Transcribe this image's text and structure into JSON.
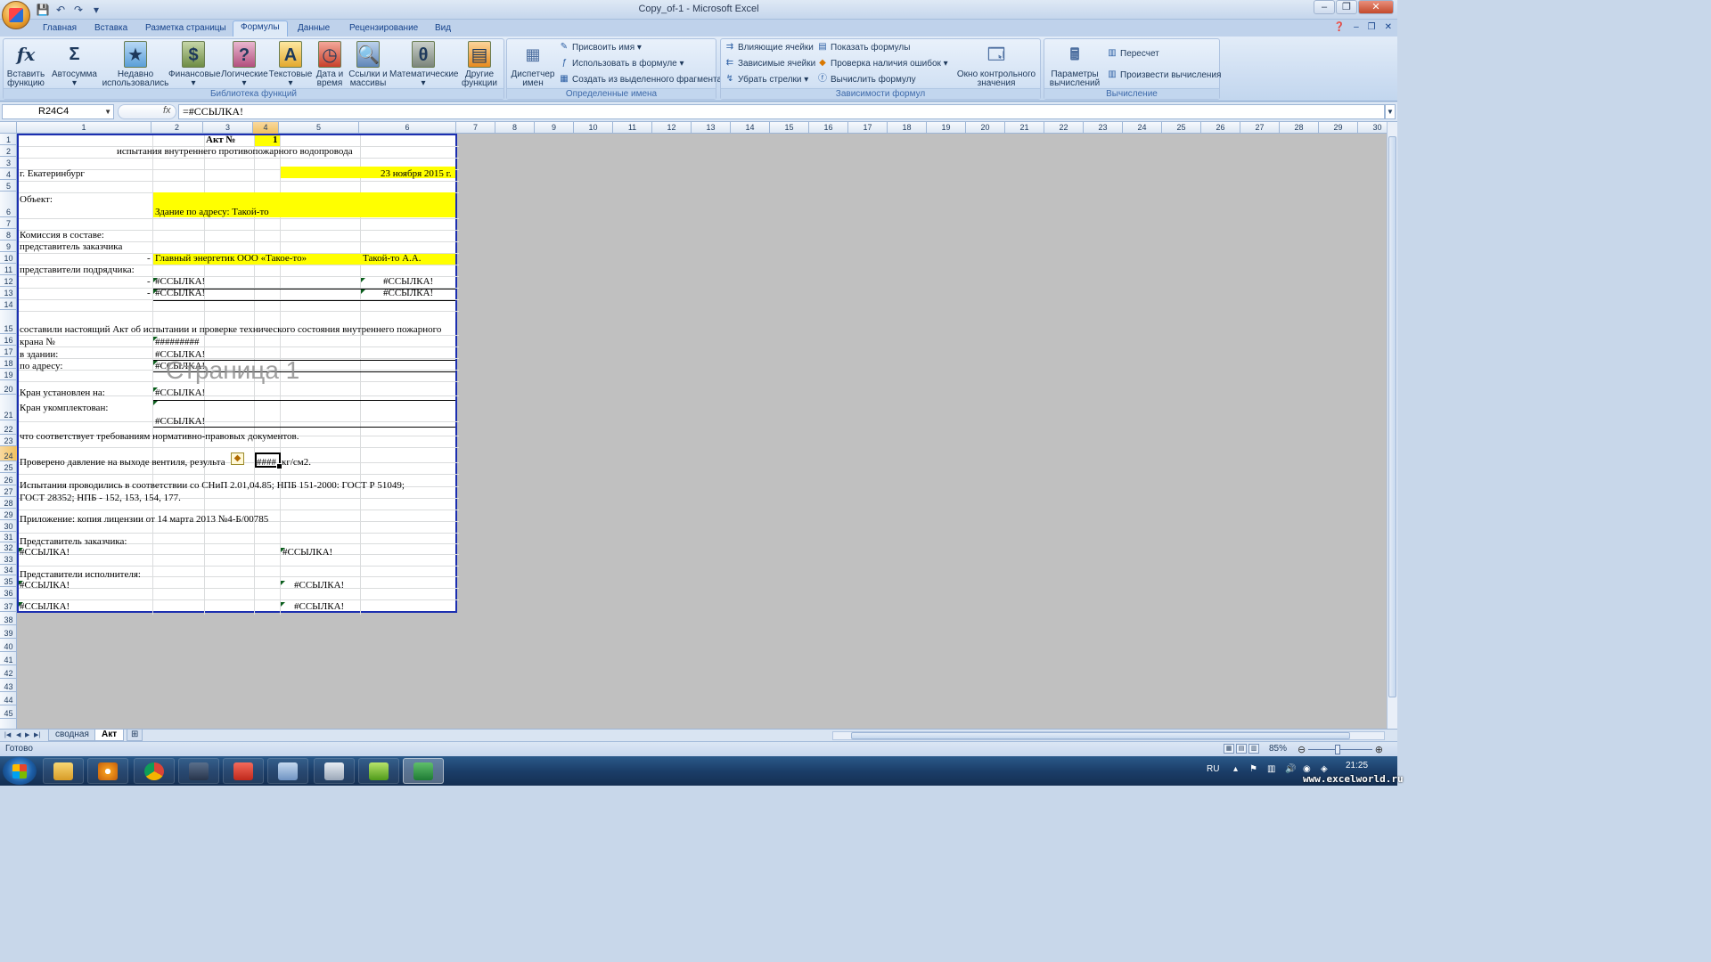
{
  "window": {
    "title": "Copy_of-1 - Microsoft Excel"
  },
  "tabs": [
    "Главная",
    "Вставка",
    "Разметка страницы",
    "Формулы",
    "Данные",
    "Рецензирование",
    "Вид"
  ],
  "active_tab": "Формулы",
  "ribbon": {
    "groups": {
      "library": "Библиотека функций",
      "names": "Определенные имена",
      "dependencies": "Зависимости формул",
      "calculation": "Вычисление"
    },
    "buttons": {
      "insert_function": "Вставить\nфункцию",
      "autosum": "Автосумма",
      "recent": "Недавно\nиспользовались",
      "financial": "Финансовые",
      "logical": "Логические",
      "text": "Текстовые",
      "datetime": "Дата и\nвремя",
      "lookup": "Ссылки и\nмассивы",
      "math": "Математические",
      "other": "Другие\nфункции",
      "name_manager": "Диспетчер\nимен",
      "define_name": "Присвоить имя",
      "use_in_formula": "Использовать в формуле",
      "create_from_selection": "Создать из выделенного фрагмента",
      "trace_precedents": "Влияющие ячейки",
      "trace_dependents": "Зависимые ячейки",
      "remove_arrows": "Убрать стрелки",
      "show_formulas": "Показать формулы",
      "error_checking": "Проверка наличия ошибок",
      "evaluate_formula": "Вычислить формулу",
      "watch_window": "Окно контрольного\nзначения",
      "calc_options": "Параметры\nвычислений",
      "calc_now": "Пересчет",
      "calc_sheet": "Произвести вычисления"
    }
  },
  "formula_bar": {
    "name_box": "R24C4",
    "formula": "=#ССЫЛКА!"
  },
  "columns": [
    "1",
    "2",
    "3",
    "4",
    "5",
    "6",
    "7",
    "8",
    "9",
    "10",
    "11",
    "12",
    "13",
    "14",
    "15",
    "16",
    "17",
    "18",
    "19",
    "20",
    "21",
    "22",
    "23",
    "24",
    "25",
    "26",
    "27",
    "28",
    "29",
    "30"
  ],
  "rows": [
    "1",
    "2",
    "3",
    "4",
    "5",
    "6",
    "7",
    "8",
    "9",
    "10",
    "11",
    "12",
    "13",
    "14",
    "15",
    "16",
    "17",
    "18",
    "19",
    "20",
    "21",
    "22",
    "23",
    "24",
    "25",
    "26",
    "27",
    "28",
    "29",
    "30",
    "31",
    "32",
    "33",
    "34",
    "35",
    "36",
    "37",
    "38",
    "39",
    "40",
    "41",
    "42",
    "43",
    "44",
    "45"
  ],
  "sheet": {
    "r1_akt": "Акт №",
    "r1_num": "1",
    "r2": "испытания внутреннего противопожарного водопровода",
    "r4_city": "г. Екатеринбург",
    "r4_date": "23 ноября 2015 г.",
    "r6_object": "Объект:",
    "r6_building": "Здание по адресу: Такой-то",
    "r8": "Комиссия в составе:",
    "r9": "представитель заказчика",
    "r10_dash": "-",
    "r10_role": "Главный энергетик ООО «Такое-то»",
    "r10_name": "Такой-то А.А.",
    "r11": "представители подрядчика:",
    "r12_dash": "-",
    "r12_a": "#ССЫЛКА!",
    "r12_b": "#ССЫЛКА!",
    "r13_dash": "-",
    "r13_a": "#ССЫЛКА!",
    "r13_b": "#ССЫЛКА!",
    "r15": "составили настоящий Акт об испытании и проверке технического состояния внутреннего пожарного",
    "r16_label": "крана №",
    "r16_val": "#########",
    "r17_label": "в здании:",
    "r17_val": "#ССЫЛКА!",
    "r18_label": "по адресу:",
    "r18_val": "#ССЫЛКА!",
    "r20_label": "Кран установлен на:",
    "r20_val": "#ССЫЛКА!",
    "r21_label": "Кран укомплектован:",
    "r21_val": "#ССЫЛКА!",
    "r22": "что соответствует требованиям нормативно-правовых документов.",
    "r24_label": "Проверено давление на выходе вентиля, результа",
    "r24_val": "####",
    "r24_unit": "кг/см2.",
    "r26_a": "Испытания проводились в соответствии со СНиП 2.01,04.85; НПБ 151-2000: ГОСТ Р 51049;",
    "r26_b": "ГОСТ 28352; НПБ - 152, 153, 154, 177.",
    "r28": "Приложение: копия лицензии от 14 марта 2013 №4-Б/00785",
    "r30": "Представитель заказчика:",
    "r31_a": "#ССЫЛКА!",
    "r31_b": "#ССЫЛКА!",
    "r33": "Представители исполнителя:",
    "r34_a": "#ССЫЛКА!",
    "r34_b": "#ССЫЛКА!",
    "r36_a": "#ССЫЛКА!",
    "r36_b": "#ССЫЛКА!",
    "page_label": "Страница 1"
  },
  "sheet_tabs": [
    "сводная",
    "Акт"
  ],
  "active_sheet": "Акт",
  "status": {
    "ready": "Готово",
    "zoom": "85%"
  },
  "taskbar": {
    "lang": "RU",
    "time": "21:25"
  },
  "watermark": "www.excelworld.ru"
}
